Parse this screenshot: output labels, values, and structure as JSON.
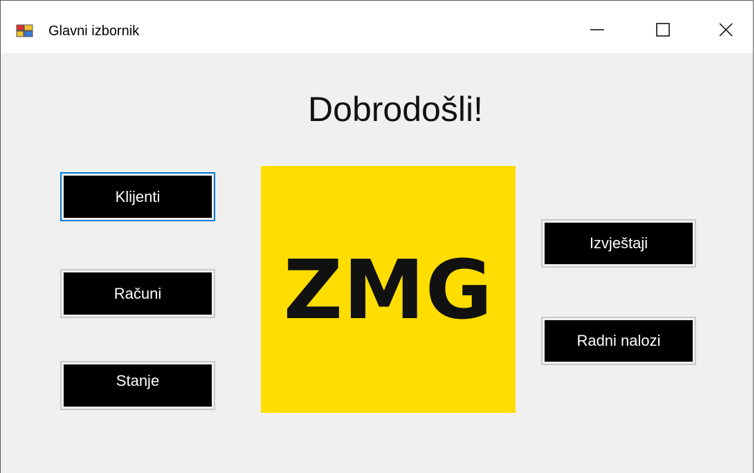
{
  "window": {
    "title": "Glavni izbornik",
    "controls": {
      "minimize": "minimize",
      "maximize": "maximize",
      "close": "close"
    }
  },
  "main": {
    "heading": "Dobrodošli!",
    "logo_text": "ZMG",
    "logo_color": "#ffdd00",
    "buttons": {
      "klijenti": "Klijenti",
      "racuni": "Računi",
      "stanje": "Stanje",
      "izvjestaji": "Izvještaji",
      "radni_nalozi": "Radni nalozi"
    }
  }
}
